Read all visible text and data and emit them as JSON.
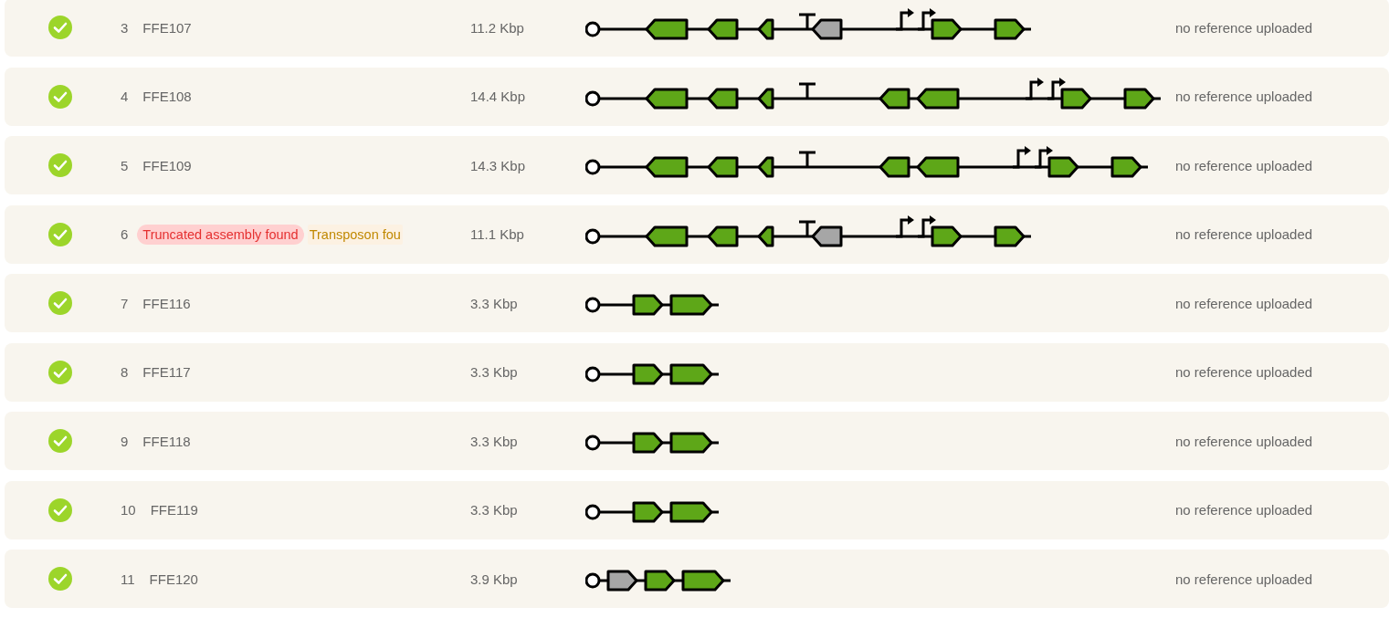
{
  "rows": [
    {
      "passed": true,
      "index": "3",
      "name": "FFE107",
      "size": "11.2 Kbp",
      "reference": "no reference uploaded",
      "features": [
        {
          "kind": "origin"
        },
        {
          "kind": "spacer"
        },
        {
          "kind": "spacer"
        },
        {
          "kind": "spacer"
        },
        {
          "kind": "gene",
          "long": true,
          "short": false,
          "reverse": true,
          "color": "#5ea718"
        },
        {
          "kind": "spacer"
        },
        {
          "kind": "gene",
          "long": false,
          "short": false,
          "reverse": true,
          "color": "#5ea718"
        },
        {
          "kind": "spacer"
        },
        {
          "kind": "gene",
          "long": false,
          "short": true,
          "reverse": true,
          "color": "#5ea718"
        },
        {
          "kind": "spacer"
        },
        {
          "kind": "spacer"
        },
        {
          "kind": "terminator"
        },
        {
          "kind": "gene",
          "long": false,
          "short": false,
          "reverse": true,
          "color": "#a6a6a6"
        },
        {
          "kind": "spacer"
        },
        {
          "kind": "spacer"
        },
        {
          "kind": "spacer"
        },
        {
          "kind": "spacer"
        },
        {
          "kind": "promoter"
        },
        {
          "kind": "spacer"
        },
        {
          "kind": "promoter"
        },
        {
          "kind": "gene",
          "long": false,
          "short": false,
          "reverse": false,
          "color": "#5ea718"
        },
        {
          "kind": "spacer"
        },
        {
          "kind": "spacer"
        },
        {
          "kind": "gene",
          "long": false,
          "short": false,
          "reverse": false,
          "color": "#5ea718"
        }
      ]
    },
    {
      "passed": true,
      "index": "4",
      "name": "FFE108",
      "size": "14.4 Kbp",
      "reference": "no reference uploaded",
      "features": [
        {
          "kind": "origin"
        },
        {
          "kind": "spacer"
        },
        {
          "kind": "spacer"
        },
        {
          "kind": "spacer"
        },
        {
          "kind": "gene",
          "long": true,
          "short": false,
          "reverse": true,
          "color": "#5ea718"
        },
        {
          "kind": "spacer"
        },
        {
          "kind": "gene",
          "long": false,
          "short": false,
          "reverse": true,
          "color": "#5ea718"
        },
        {
          "kind": "spacer"
        },
        {
          "kind": "gene",
          "long": false,
          "short": true,
          "reverse": true,
          "color": "#5ea718"
        },
        {
          "kind": "spacer"
        },
        {
          "kind": "spacer"
        },
        {
          "kind": "terminator"
        },
        {
          "kind": "spacer"
        },
        {
          "kind": "spacer"
        },
        {
          "kind": "spacer"
        },
        {
          "kind": "spacer"
        },
        {
          "kind": "spacer"
        },
        {
          "kind": "gene",
          "long": false,
          "short": false,
          "reverse": true,
          "color": "#5ea718"
        },
        {
          "kind": "gene",
          "long": true,
          "short": false,
          "reverse": true,
          "color": "#5ea718"
        },
        {
          "kind": "spacer"
        },
        {
          "kind": "spacer"
        },
        {
          "kind": "spacer"
        },
        {
          "kind": "spacer"
        },
        {
          "kind": "spacer"
        },
        {
          "kind": "promoter"
        },
        {
          "kind": "spacer"
        },
        {
          "kind": "promoter"
        },
        {
          "kind": "gene",
          "long": false,
          "short": false,
          "reverse": false,
          "color": "#5ea718"
        },
        {
          "kind": "spacer"
        },
        {
          "kind": "spacer"
        },
        {
          "kind": "gene",
          "long": false,
          "short": false,
          "reverse": false,
          "color": "#5ea718"
        }
      ]
    },
    {
      "passed": true,
      "index": "5",
      "name": "FFE109",
      "size": "14.3 Kbp",
      "reference": "no reference uploaded",
      "features": [
        {
          "kind": "origin"
        },
        {
          "kind": "spacer"
        },
        {
          "kind": "spacer"
        },
        {
          "kind": "spacer"
        },
        {
          "kind": "gene",
          "long": true,
          "short": false,
          "reverse": true,
          "color": "#5ea718"
        },
        {
          "kind": "spacer"
        },
        {
          "kind": "gene",
          "long": false,
          "short": false,
          "reverse": true,
          "color": "#5ea718"
        },
        {
          "kind": "spacer"
        },
        {
          "kind": "gene",
          "long": false,
          "short": true,
          "reverse": true,
          "color": "#5ea718"
        },
        {
          "kind": "spacer"
        },
        {
          "kind": "spacer"
        },
        {
          "kind": "terminator"
        },
        {
          "kind": "spacer"
        },
        {
          "kind": "spacer"
        },
        {
          "kind": "spacer"
        },
        {
          "kind": "spacer"
        },
        {
          "kind": "spacer"
        },
        {
          "kind": "gene",
          "long": false,
          "short": false,
          "reverse": true,
          "color": "#5ea718"
        },
        {
          "kind": "gene",
          "long": true,
          "short": false,
          "reverse": true,
          "color": "#5ea718"
        },
        {
          "kind": "spacer"
        },
        {
          "kind": "spacer"
        },
        {
          "kind": "spacer"
        },
        {
          "kind": "spacer"
        },
        {
          "kind": "promoter"
        },
        {
          "kind": "spacer"
        },
        {
          "kind": "promoter"
        },
        {
          "kind": "gene",
          "long": false,
          "short": false,
          "reverse": false,
          "color": "#5ea718"
        },
        {
          "kind": "spacer"
        },
        {
          "kind": "spacer"
        },
        {
          "kind": "gene",
          "long": false,
          "short": false,
          "reverse": false,
          "color": "#5ea718"
        }
      ]
    },
    {
      "passed": true,
      "index": "6",
      "tags": [
        {
          "kind": "error",
          "text": "Truncated assembly found"
        },
        {
          "kind": "warning",
          "text": "Transposon fou"
        }
      ],
      "size": "11.1 Kbp",
      "reference": "no reference uploaded",
      "features": [
        {
          "kind": "origin"
        },
        {
          "kind": "spacer"
        },
        {
          "kind": "spacer"
        },
        {
          "kind": "spacer"
        },
        {
          "kind": "gene",
          "long": true,
          "short": false,
          "reverse": true,
          "color": "#5ea718"
        },
        {
          "kind": "spacer"
        },
        {
          "kind": "gene",
          "long": false,
          "short": false,
          "reverse": true,
          "color": "#5ea718"
        },
        {
          "kind": "spacer"
        },
        {
          "kind": "gene",
          "long": false,
          "short": true,
          "reverse": true,
          "color": "#5ea718"
        },
        {
          "kind": "spacer"
        },
        {
          "kind": "spacer"
        },
        {
          "kind": "terminator"
        },
        {
          "kind": "gene",
          "long": false,
          "short": false,
          "reverse": true,
          "color": "#a6a6a6"
        },
        {
          "kind": "spacer"
        },
        {
          "kind": "spacer"
        },
        {
          "kind": "spacer"
        },
        {
          "kind": "spacer"
        },
        {
          "kind": "promoter"
        },
        {
          "kind": "spacer"
        },
        {
          "kind": "promoter"
        },
        {
          "kind": "gene",
          "long": false,
          "short": false,
          "reverse": false,
          "color": "#5ea718"
        },
        {
          "kind": "spacer"
        },
        {
          "kind": "spacer"
        },
        {
          "kind": "gene",
          "long": false,
          "short": false,
          "reverse": false,
          "color": "#5ea718"
        }
      ]
    },
    {
      "passed": true,
      "index": "7",
      "name": "FFE116",
      "size": "3.3 Kbp",
      "reference": "no reference uploaded",
      "features": [
        {
          "kind": "origin"
        },
        {
          "kind": "spacer"
        },
        {
          "kind": "spacer"
        },
        {
          "kind": "gene",
          "long": false,
          "short": false,
          "reverse": false,
          "color": "#5ea718"
        },
        {
          "kind": "gene",
          "long": true,
          "short": false,
          "reverse": false,
          "color": "#5ea718"
        }
      ]
    },
    {
      "passed": true,
      "index": "8",
      "name": "FFE117",
      "size": "3.3 Kbp",
      "reference": "no reference uploaded",
      "features": [
        {
          "kind": "origin"
        },
        {
          "kind": "spacer"
        },
        {
          "kind": "spacer"
        },
        {
          "kind": "gene",
          "long": false,
          "short": false,
          "reverse": false,
          "color": "#5ea718"
        },
        {
          "kind": "gene",
          "long": true,
          "short": false,
          "reverse": false,
          "color": "#5ea718"
        }
      ]
    },
    {
      "passed": true,
      "index": "9",
      "name": "FFE118",
      "size": "3.3 Kbp",
      "reference": "no reference uploaded",
      "features": [
        {
          "kind": "origin"
        },
        {
          "kind": "spacer"
        },
        {
          "kind": "spacer"
        },
        {
          "kind": "gene",
          "long": false,
          "short": false,
          "reverse": false,
          "color": "#5ea718"
        },
        {
          "kind": "gene",
          "long": true,
          "short": false,
          "reverse": false,
          "color": "#5ea718"
        }
      ]
    },
    {
      "passed": true,
      "index": "10",
      "name": "FFE119",
      "size": "3.3 Kbp",
      "reference": "no reference uploaded",
      "features": [
        {
          "kind": "origin"
        },
        {
          "kind": "spacer"
        },
        {
          "kind": "spacer"
        },
        {
          "kind": "gene",
          "long": false,
          "short": false,
          "reverse": false,
          "color": "#5ea718"
        },
        {
          "kind": "gene",
          "long": true,
          "short": false,
          "reverse": false,
          "color": "#5ea718"
        }
      ]
    },
    {
      "passed": true,
      "index": "11",
      "name": "FFE120",
      "size": "3.9 Kbp",
      "reference": "no reference uploaded",
      "features": [
        {
          "kind": "origin"
        },
        {
          "kind": "gene",
          "long": false,
          "short": false,
          "reverse": false,
          "color": "#a6a6a6"
        },
        {
          "kind": "gene",
          "long": false,
          "short": false,
          "reverse": false,
          "color": "#5ea718"
        },
        {
          "kind": "gene",
          "long": true,
          "short": false,
          "reverse": false,
          "color": "#5ea718"
        }
      ]
    }
  ]
}
